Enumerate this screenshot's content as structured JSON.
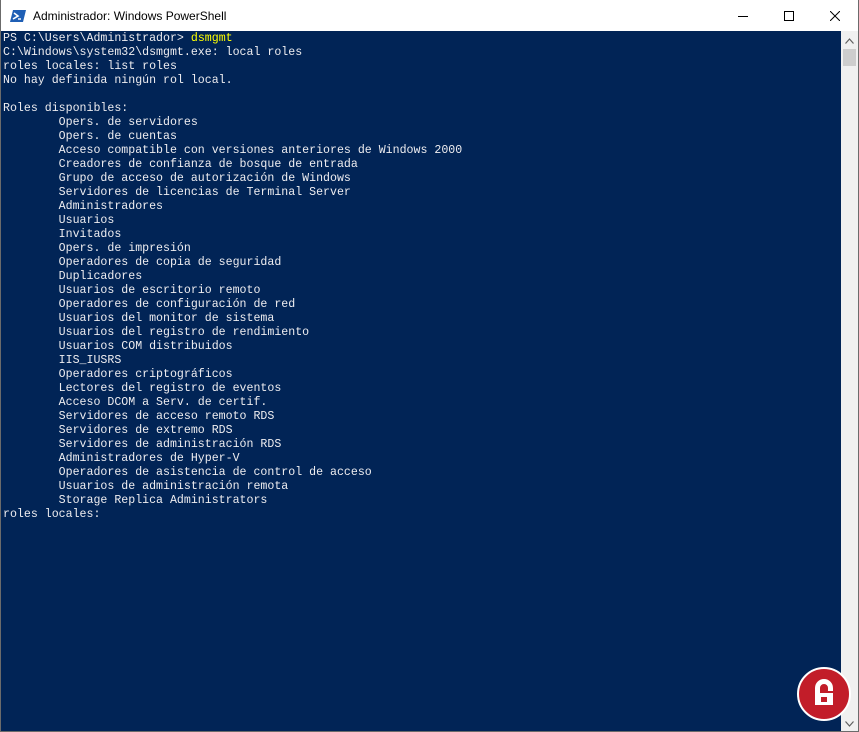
{
  "window": {
    "title": "Administrador: Windows PowerShell",
    "icon": "powershell-icon"
  },
  "controls": {
    "minimize": "minimize-icon",
    "maximize": "maximize-icon",
    "close": "close-icon"
  },
  "console": {
    "prompt": "PS C:\\Users\\Administrador> ",
    "command": "dsmgmt",
    "lines": [
      "C:\\Windows\\system32\\dsmgmt.exe: local roles",
      "roles locales: list roles",
      "No hay definida ningún rol local.",
      "",
      "Roles disponibles:",
      "        Opers. de servidores",
      "        Opers. de cuentas",
      "        Acceso compatible con versiones anteriores de Windows 2000",
      "        Creadores de confianza de bosque de entrada",
      "        Grupo de acceso de autorización de Windows",
      "        Servidores de licencias de Terminal Server",
      "        Administradores",
      "        Usuarios",
      "        Invitados",
      "        Opers. de impresión",
      "        Operadores de copia de seguridad",
      "        Duplicadores",
      "        Usuarios de escritorio remoto",
      "        Operadores de configuración de red",
      "        Usuarios del monitor de sistema",
      "        Usuarios del registro de rendimiento",
      "        Usuarios COM distribuidos",
      "        IIS_IUSRS",
      "        Operadores criptográficos",
      "        Lectores del registro de eventos",
      "        Acceso DCOM a Serv. de certif.",
      "        Servidores de acceso remoto RDS",
      "        Servidores de extremo RDS",
      "        Servidores de administración RDS",
      "        Administradores de Hyper-V",
      "        Operadores de asistencia de control de acceso",
      "        Usuarios de administración remota",
      "        Storage Replica Administrators",
      "roles locales: "
    ]
  },
  "colors": {
    "console_bg": "#012456",
    "console_text": "#eeedf0",
    "command": "#ffff00"
  }
}
